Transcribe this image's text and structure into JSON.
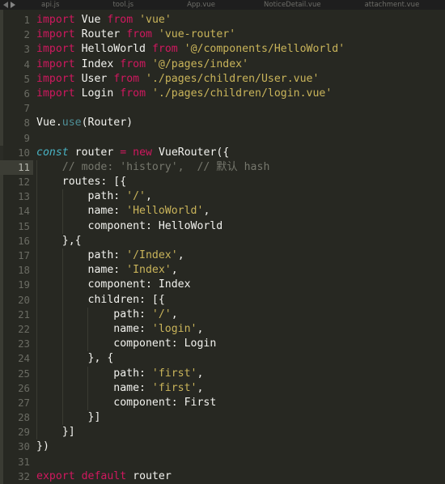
{
  "window": {
    "theme": "monokai-dark",
    "background": "#272822",
    "tabbar_background": "#1e1e1e"
  },
  "tabbar": {
    "nav_back_icon": "triangle-left-icon",
    "nav_forward_icon": "triangle-right-icon",
    "tabs": [
      {
        "label": "api.js",
        "active": false
      },
      {
        "label": "tool.js",
        "active": false
      },
      {
        "label": "App.vue",
        "active": false
      },
      {
        "label": "NoticeDetail.vue",
        "active": false
      },
      {
        "label": "attachment.vue",
        "active": false
      }
    ]
  },
  "editor": {
    "language": "javascript",
    "current_line": 11,
    "total_lines": 32,
    "colors": {
      "keyword": "#d1185f",
      "storage": "#49b3c4",
      "string": "#c9b45a",
      "comment": "#76776d",
      "text": "#f2f2ee",
      "function": "#4e8f97",
      "gutter_text": "#6a6b63",
      "current_line_gutter": "#3c3d35",
      "indent_guide": "#3a3b33"
    },
    "lines": [
      {
        "n": 1,
        "indent": 0,
        "tokens": [
          {
            "t": "import",
            "c": "kw"
          },
          {
            "t": " ",
            "c": "pun"
          },
          {
            "t": "Vue",
            "c": "id"
          },
          {
            "t": " ",
            "c": "pun"
          },
          {
            "t": "from",
            "c": "kw"
          },
          {
            "t": " ",
            "c": "pun"
          },
          {
            "t": "'vue'",
            "c": "str"
          }
        ]
      },
      {
        "n": 2,
        "indent": 0,
        "tokens": [
          {
            "t": "import",
            "c": "kw"
          },
          {
            "t": " ",
            "c": "pun"
          },
          {
            "t": "Router",
            "c": "id"
          },
          {
            "t": " ",
            "c": "pun"
          },
          {
            "t": "from",
            "c": "kw"
          },
          {
            "t": " ",
            "c": "pun"
          },
          {
            "t": "'vue-router'",
            "c": "str"
          }
        ]
      },
      {
        "n": 3,
        "indent": 0,
        "tokens": [
          {
            "t": "import",
            "c": "kw"
          },
          {
            "t": " ",
            "c": "pun"
          },
          {
            "t": "HelloWorld",
            "c": "id"
          },
          {
            "t": " ",
            "c": "pun"
          },
          {
            "t": "from",
            "c": "kw"
          },
          {
            "t": " ",
            "c": "pun"
          },
          {
            "t": "'@/components/HelloWorld'",
            "c": "str"
          }
        ]
      },
      {
        "n": 4,
        "indent": 0,
        "tokens": [
          {
            "t": "import",
            "c": "kw"
          },
          {
            "t": " ",
            "c": "pun"
          },
          {
            "t": "Index",
            "c": "id"
          },
          {
            "t": " ",
            "c": "pun"
          },
          {
            "t": "from",
            "c": "kw"
          },
          {
            "t": " ",
            "c": "pun"
          },
          {
            "t": "'@/pages/index'",
            "c": "str"
          }
        ]
      },
      {
        "n": 5,
        "indent": 0,
        "tokens": [
          {
            "t": "import",
            "c": "kw"
          },
          {
            "t": " ",
            "c": "pun"
          },
          {
            "t": "User",
            "c": "id"
          },
          {
            "t": " ",
            "c": "pun"
          },
          {
            "t": "from",
            "c": "kw"
          },
          {
            "t": " ",
            "c": "pun"
          },
          {
            "t": "'./pages/children/User.vue'",
            "c": "str"
          }
        ]
      },
      {
        "n": 6,
        "indent": 0,
        "tokens": [
          {
            "t": "import",
            "c": "kw"
          },
          {
            "t": " ",
            "c": "pun"
          },
          {
            "t": "Login",
            "c": "id"
          },
          {
            "t": " ",
            "c": "pun"
          },
          {
            "t": "from",
            "c": "kw"
          },
          {
            "t": " ",
            "c": "pun"
          },
          {
            "t": "'./pages/children/login.vue'",
            "c": "str"
          }
        ]
      },
      {
        "n": 7,
        "indent": 0,
        "tokens": []
      },
      {
        "n": 8,
        "indent": 0,
        "tokens": [
          {
            "t": "Vue",
            "c": "id"
          },
          {
            "t": ".",
            "c": "pun"
          },
          {
            "t": "use",
            "c": "fn"
          },
          {
            "t": "(Router)",
            "c": "pun"
          }
        ]
      },
      {
        "n": 9,
        "indent": 0,
        "tokens": []
      },
      {
        "n": 10,
        "indent": 0,
        "tokens": [
          {
            "t": "const",
            "c": "kw2"
          },
          {
            "t": " ",
            "c": "pun"
          },
          {
            "t": "router",
            "c": "id"
          },
          {
            "t": " ",
            "c": "pun"
          },
          {
            "t": "=",
            "c": "kw"
          },
          {
            "t": " ",
            "c": "pun"
          },
          {
            "t": "new",
            "c": "kw"
          },
          {
            "t": " ",
            "c": "pun"
          },
          {
            "t": "VueRouter({",
            "c": "pun"
          }
        ]
      },
      {
        "n": 11,
        "indent": 1,
        "tokens": [
          {
            "t": "    // mode: 'history',  // 默认 hash",
            "c": "cm"
          }
        ]
      },
      {
        "n": 12,
        "indent": 1,
        "tokens": [
          {
            "t": "    routes: [{",
            "c": "pun"
          }
        ]
      },
      {
        "n": 13,
        "indent": 2,
        "tokens": [
          {
            "t": "        path: ",
            "c": "pun"
          },
          {
            "t": "'/'",
            "c": "str"
          },
          {
            "t": ",",
            "c": "pun"
          }
        ]
      },
      {
        "n": 14,
        "indent": 2,
        "tokens": [
          {
            "t": "        name: ",
            "c": "pun"
          },
          {
            "t": "'HelloWorld'",
            "c": "str"
          },
          {
            "t": ",",
            "c": "pun"
          }
        ]
      },
      {
        "n": 15,
        "indent": 2,
        "tokens": [
          {
            "t": "        component: HelloWorld",
            "c": "pun"
          }
        ]
      },
      {
        "n": 16,
        "indent": 1,
        "tokens": [
          {
            "t": "    },{",
            "c": "pun"
          }
        ]
      },
      {
        "n": 17,
        "indent": 2,
        "tokens": [
          {
            "t": "        path: ",
            "c": "pun"
          },
          {
            "t": "'/Index'",
            "c": "str"
          },
          {
            "t": ",",
            "c": "pun"
          }
        ]
      },
      {
        "n": 18,
        "indent": 2,
        "tokens": [
          {
            "t": "        name: ",
            "c": "pun"
          },
          {
            "t": "'Index'",
            "c": "str"
          },
          {
            "t": ",",
            "c": "pun"
          }
        ]
      },
      {
        "n": 19,
        "indent": 2,
        "tokens": [
          {
            "t": "        component: Index",
            "c": "pun"
          }
        ]
      },
      {
        "n": 20,
        "indent": 2,
        "tokens": [
          {
            "t": "        children: [{",
            "c": "pun"
          }
        ]
      },
      {
        "n": 21,
        "indent": 3,
        "tokens": [
          {
            "t": "            path: ",
            "c": "pun"
          },
          {
            "t": "'/'",
            "c": "str"
          },
          {
            "t": ",",
            "c": "pun"
          }
        ]
      },
      {
        "n": 22,
        "indent": 3,
        "tokens": [
          {
            "t": "            name: ",
            "c": "pun"
          },
          {
            "t": "'login'",
            "c": "str"
          },
          {
            "t": ",",
            "c": "pun"
          }
        ]
      },
      {
        "n": 23,
        "indent": 3,
        "tokens": [
          {
            "t": "            component: Login",
            "c": "pun"
          }
        ]
      },
      {
        "n": 24,
        "indent": 2,
        "tokens": [
          {
            "t": "        }, {",
            "c": "pun"
          }
        ]
      },
      {
        "n": 25,
        "indent": 3,
        "tokens": [
          {
            "t": "            path: ",
            "c": "pun"
          },
          {
            "t": "'first'",
            "c": "str"
          },
          {
            "t": ",",
            "c": "pun"
          }
        ]
      },
      {
        "n": 26,
        "indent": 3,
        "tokens": [
          {
            "t": "            name: ",
            "c": "pun"
          },
          {
            "t": "'first'",
            "c": "str"
          },
          {
            "t": ",",
            "c": "pun"
          }
        ]
      },
      {
        "n": 27,
        "indent": 3,
        "tokens": [
          {
            "t": "            component: First",
            "c": "pun"
          }
        ]
      },
      {
        "n": 28,
        "indent": 2,
        "tokens": [
          {
            "t": "        }]",
            "c": "pun"
          }
        ]
      },
      {
        "n": 29,
        "indent": 1,
        "tokens": [
          {
            "t": "    }]",
            "c": "pun"
          }
        ]
      },
      {
        "n": 30,
        "indent": 0,
        "tokens": [
          {
            "t": "})",
            "c": "pun"
          }
        ]
      },
      {
        "n": 31,
        "indent": 0,
        "tokens": []
      },
      {
        "n": 32,
        "indent": 0,
        "tokens": [
          {
            "t": "export",
            "c": "kw"
          },
          {
            "t": " ",
            "c": "pun"
          },
          {
            "t": "default",
            "c": "kw"
          },
          {
            "t": " ",
            "c": "pun"
          },
          {
            "t": "router",
            "c": "id"
          }
        ]
      }
    ]
  }
}
